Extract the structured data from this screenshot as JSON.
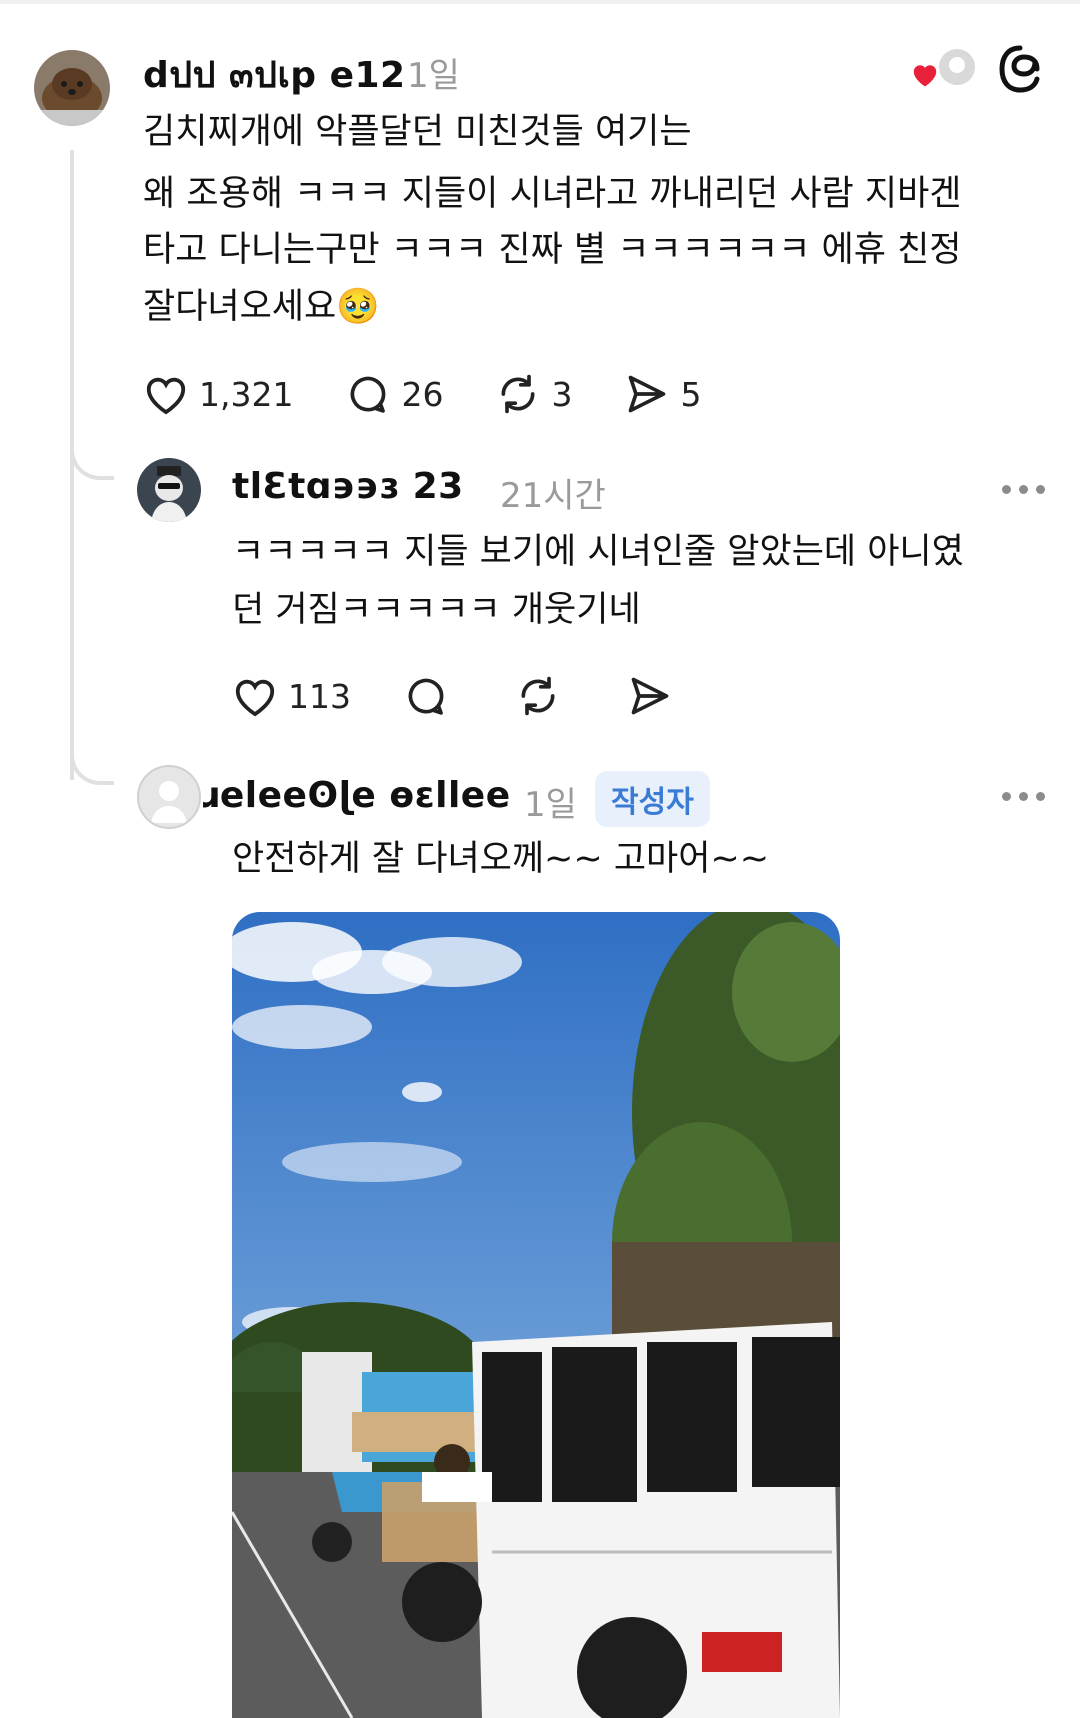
{
  "comment1": {
    "username": "dปป ๓ปเр e12",
    "time": "1일",
    "lines": [
      "김치찌개에 악플달던 미친것들 여기는",
      "왜 조용해 ㅋㅋㅋ 지들이 시녀라고 까내리던 사람 지바겐",
      "타고 다니는구만 ㅋㅋㅋ 진짜 별 ㅋㅋㅋㅋㅋㅋ 에휴 친정",
      "잘다녀오세요🥹"
    ],
    "likes": "1,321",
    "replies": "26",
    "reposts": "3",
    "shares": "5"
  },
  "comment2": {
    "username": "tlԐtɑ϶϶ɜ 23",
    "time": "21시간",
    "lines": [
      "ㅋㅋㅋㅋㅋ 지들 보기에 시녀인줄 알았는데 아니였",
      "던 거짐ㅋㅋㅋㅋㅋ 개웃기네"
    ],
    "likes": "113"
  },
  "comment3": {
    "username": "ɹeleeʘɭe ɵεllee",
    "time": "1일",
    "badge": "작성자",
    "text": "안전하게 잘 다녀오께~~ 고마어~~"
  },
  "colors": {
    "heart_red": "#e8203a",
    "badge_bg": "#e8f1fb",
    "badge_text": "#3a7bd5",
    "meta_gray": "#9a9a9a"
  },
  "icons": [
    "heart-icon",
    "comment-icon",
    "repost-icon",
    "share-icon",
    "threads-logo-icon",
    "more-icon"
  ]
}
